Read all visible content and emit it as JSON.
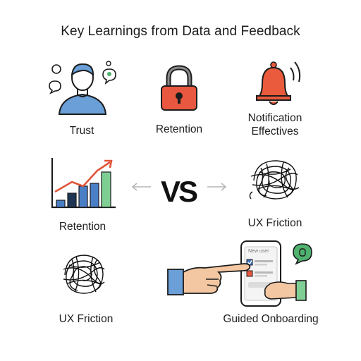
{
  "title": "Key Learnings from Data and Feedback",
  "center_label": "VS",
  "items": [
    {
      "label": "Trust",
      "icon": "person-chat-icon"
    },
    {
      "label": "Retention",
      "icon": "padlock-icon"
    },
    {
      "label": "Notification Effectives",
      "label_line1": "Notification",
      "label_line2": "Effectives",
      "icon": "bell-icon"
    },
    {
      "label": "Retention",
      "icon": "growth-chart-icon"
    },
    {
      "label": "UX Friction",
      "icon": "scribble-icon"
    },
    {
      "label": "UX Friction",
      "icon": "scribble-icon"
    },
    {
      "label": "Guided Onboarding",
      "icon": "onboarding-phone-icon",
      "phone_header": "New user"
    }
  ],
  "colors": {
    "person_blue": "#6a9fd8",
    "lock_red": "#e8573f",
    "bell_red": "#ea5a3c",
    "bar_blue": "#4a7fc6",
    "bar_green": "#7fcf95",
    "trend_red": "#e0553a",
    "check_blue": "#3e74c4",
    "chat_green": "#4fb26f"
  }
}
